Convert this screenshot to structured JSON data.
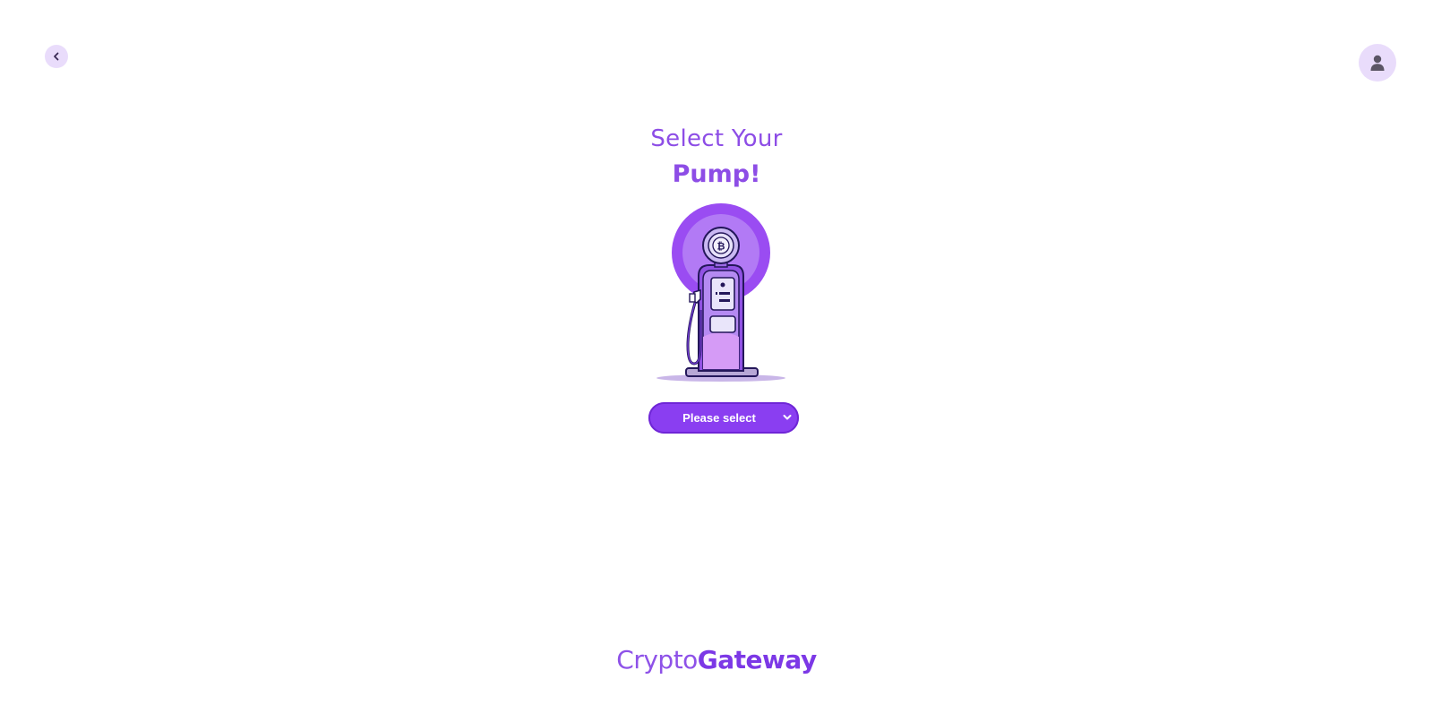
{
  "header": {
    "back_icon": "chevron-left-icon",
    "profile_icon": "user-icon"
  },
  "main": {
    "title_line1": "Select Your",
    "title_line2": "Pump!",
    "illustration": "bitcoin-fuel-pump",
    "pump_select": {
      "selected_value": "Please select",
      "icon": "chevron-down-icon"
    }
  },
  "footer": {
    "brand_light": "Crypto",
    "brand_bold": "Gateway"
  },
  "colors": {
    "accent": "#8a3ef1",
    "accent_light": "#e9dcfb",
    "title": "#8d4de6"
  }
}
